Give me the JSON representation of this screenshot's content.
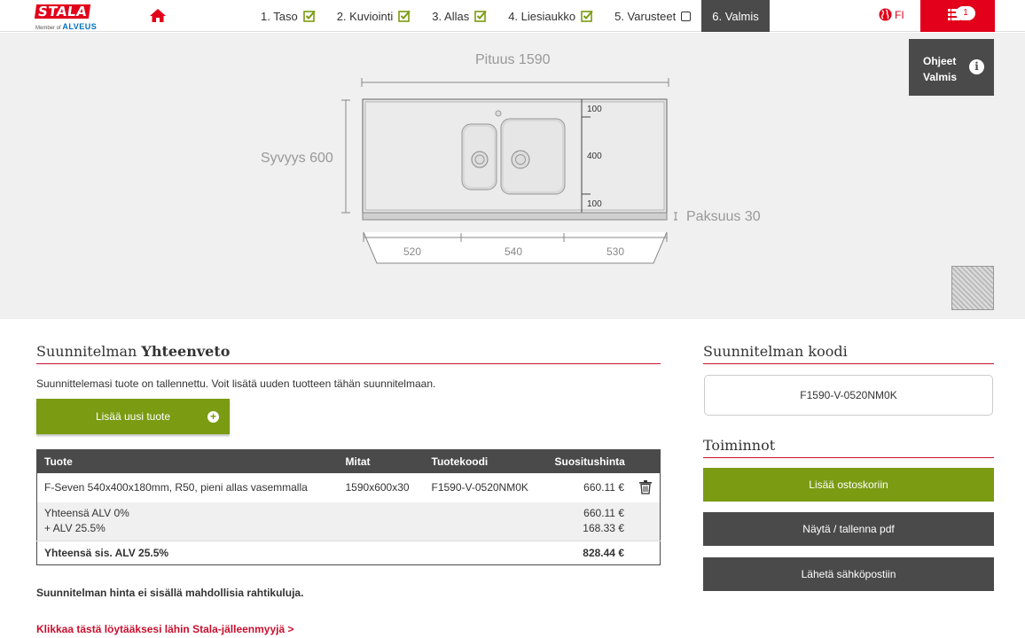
{
  "header": {
    "logo_text": "STALA",
    "logo_sub": "Member of",
    "logo_brand": "ALVEUS",
    "steps": [
      {
        "label": "1. Taso",
        "state": "done"
      },
      {
        "label": "2. Kuviointi",
        "state": "done"
      },
      {
        "label": "3. Allas",
        "state": "done"
      },
      {
        "label": "4. Liesiaukko",
        "state": "done"
      },
      {
        "label": "5. Varusteet",
        "state": "unchecked"
      },
      {
        "label": "6. Valmis",
        "state": "active"
      }
    ],
    "language": "FI",
    "cart_count": "1"
  },
  "canvas": {
    "help_line1": "Ohjeet",
    "help_line2": "Valmis",
    "length_label": "Pituus 1590",
    "depth_label": "Syvyys 600",
    "thickness_label": "Paksuus 30",
    "right_dims": [
      "100",
      "400",
      "100"
    ],
    "bottom_dims": [
      "520",
      "540",
      "530"
    ]
  },
  "summary": {
    "title_light": "Suunnitelman",
    "title_bold": "Yhteenveto",
    "saved_note": "Suunnittelemasi tuote on tallennettu. Voit lisätä uuden tuotteen tähän suunnitelmaan.",
    "add_button": "Lisää uusi tuote",
    "table": {
      "headers": [
        "Tuote",
        "Mitat",
        "Tuotekoodi",
        "Suositushinta"
      ],
      "item": {
        "name": "F-Seven 540x400x180mm, R50, pieni allas vasemmalla",
        "size": "1590x600x30",
        "code": "F1590-V-0520NM0K",
        "price": "660.11 €"
      },
      "subtotal_label": "Yhteensä ALV 0%",
      "subtotal_value": "660.11 €",
      "vat_label": "+ ALV 25.5%",
      "vat_value": "168.33 €",
      "total_label": "Yhteensä sis. ALV 25.5%",
      "total_value": "828.44 €"
    },
    "price_note": "Suunnitelman hinta ei sisällä mahdollisia rahtikuluja.",
    "dealer_link": "Klikkaa tästä löytääksesi lähin Stala-jälleenmyyjä >"
  },
  "sidebar": {
    "code_title": "Suunnitelman koodi",
    "code_value": "F1590-V-0520NM0K",
    "actions_title": "Toiminnot",
    "actions": [
      "Lisää ostoskoriin",
      "Näytä / tallenna pdf",
      "Lähetä sähköpostiin"
    ]
  },
  "colors": {
    "brand_red": "#e2001a",
    "accent_green": "#7a9b12",
    "dark_gray": "#4a4a4a"
  }
}
